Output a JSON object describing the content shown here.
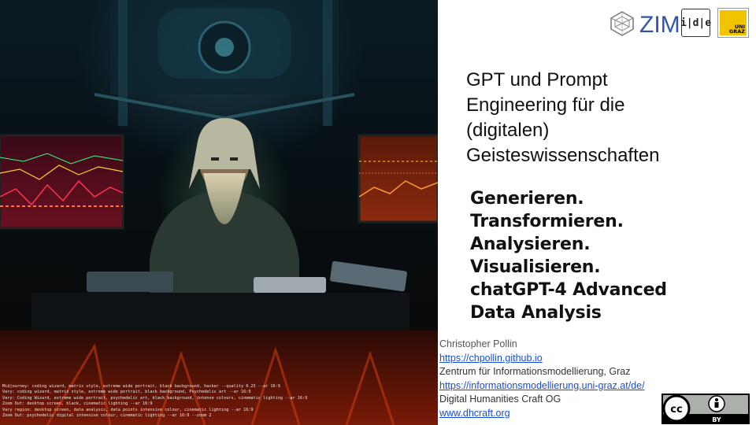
{
  "prompt_log": [
    "Midjourney: coding wizard, matrix style, extreme wide portrait, black background, hacker --quality 0.25 --ar 16:9",
    "Vary: coding wizard, matrix style, extreme wide portrait, black background, Psychedelic art --ar 16:9",
    "Vary: Coding Wizard, extreme wide portrait, psychedelic art, black background, intense colours, cinematic lighting --ar 16:9",
    "Zoom Out: desktop screen, black, cinematic lighting --ar 16:9",
    "Vary region: desktop screen, data analysis, data points intensive colour, cinematic lighting --ar 16:9",
    "Zoom Out: psychodelic digital intensive colour, cinematic lighting --ar 16:9 --zoom 2"
  ],
  "logos": {
    "zim": "ZIM",
    "idhe": "i|d|e",
    "unigraz": "UNI GRAZ"
  },
  "title_lines": [
    "GPT und Prompt",
    "Engineering für die",
    "(digitalen)",
    "Geisteswissenschaften"
  ],
  "subtitle_lines": [
    "Generieren.",
    "Transformieren.",
    "Analysieren.",
    "Visualisieren.",
    "chatGPT-4 Advanced",
    "Data Analysis"
  ],
  "contact": {
    "name": "Christopher Pollin",
    "url1": "https://chpollin.github.io",
    "org1": "Zentrum für Informationsmodellierung, Graz",
    "url2": "https://informationsmodellierung.uni-graz.at/de/",
    "org2": "Digital Humanities Craft OG",
    "url3": "www.dhcraft.org"
  },
  "license": {
    "cc": "cc",
    "by": "BY"
  },
  "colors": {
    "link": "#1a4fcc",
    "text": "#111111",
    "unigraz_yellow": "#f2c400"
  }
}
